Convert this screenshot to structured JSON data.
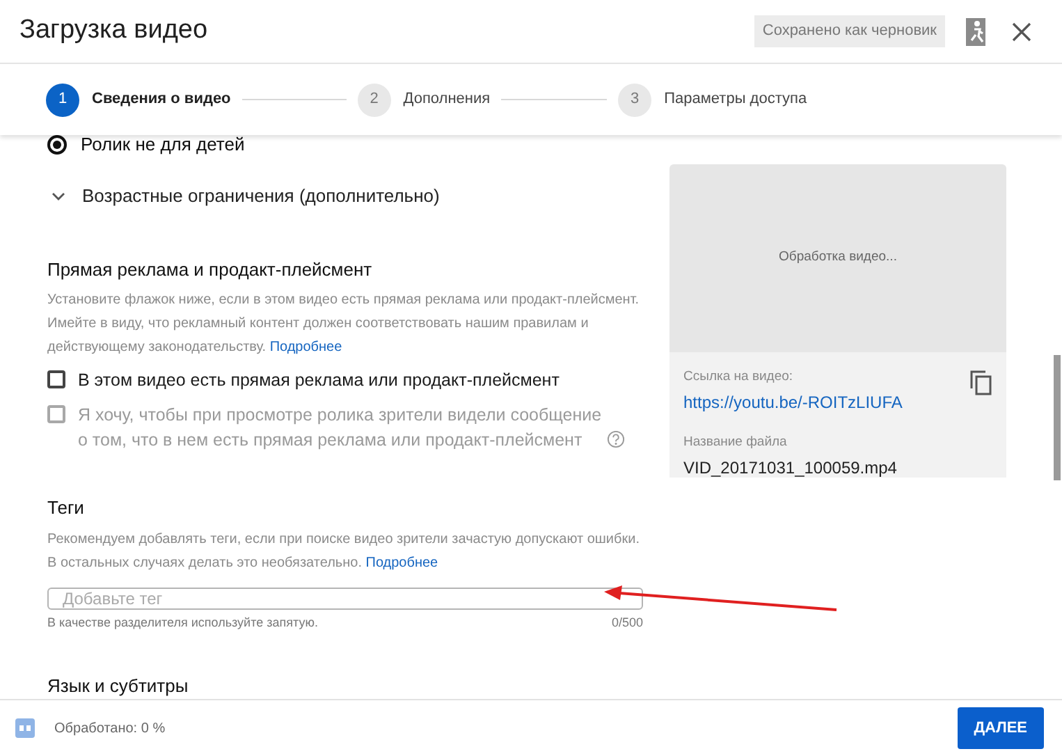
{
  "window": {
    "title": "Загрузка видео",
    "draft_badge": "Сохранено как черновик"
  },
  "steps": [
    {
      "number": "1",
      "label": "Сведения о видео",
      "selected": true
    },
    {
      "number": "2",
      "label": "Дополнения",
      "selected": false
    },
    {
      "number": "3",
      "label": "Параметры доступа",
      "selected": false
    }
  ],
  "audience_radio": {
    "label": "Ролик не для детей",
    "selected": true
  },
  "age_restrictions": {
    "label": "Возрастные ограничения (дополнительно)",
    "expanded": false
  },
  "paid_promotion": {
    "heading": "Прямая реклама и продакт-плейсмент",
    "description": "Установите флажок ниже, если в этом видео есть прямая реклама или продакт-плейсмент. Имейте в виду, что рекламный контент должен соответствовать нашим правилам и действующему законодательству.",
    "link": "Подробнее",
    "checkboxes": [
      {
        "label": "В этом видео есть прямая реклама или продакт-плейсмент",
        "checked": false,
        "disabled": false
      },
      {
        "label": "Я хочу, чтобы при просмотре ролика зрители видели сообщение о том, что в нем есть прямая реклама или продакт-плейсмент",
        "checked": false,
        "disabled": true
      }
    ]
  },
  "tags": {
    "heading": "Теги",
    "description": "Рекомендуем добавлять теги, если при поиске видео зрители зачастую допускают ошибки. В остальных случаях делать это необязательно.",
    "link": "Подробнее",
    "placeholder": "Добавьте тег",
    "helper": "В качестве разделителя используйте запятую.",
    "counter": "0/500"
  },
  "language_heading": "Язык и субтитры",
  "preview": {
    "status": "Обработка видео...",
    "link_label": "Ссылка на видео:",
    "link": "https://youtu.be/-ROITzLIUFA",
    "file_label": "Название файла",
    "file_name": "VID_20171031_100059.mp4"
  },
  "footer": {
    "status": "Обработано: 0 %",
    "next_button": "ДАЛЕЕ"
  }
}
